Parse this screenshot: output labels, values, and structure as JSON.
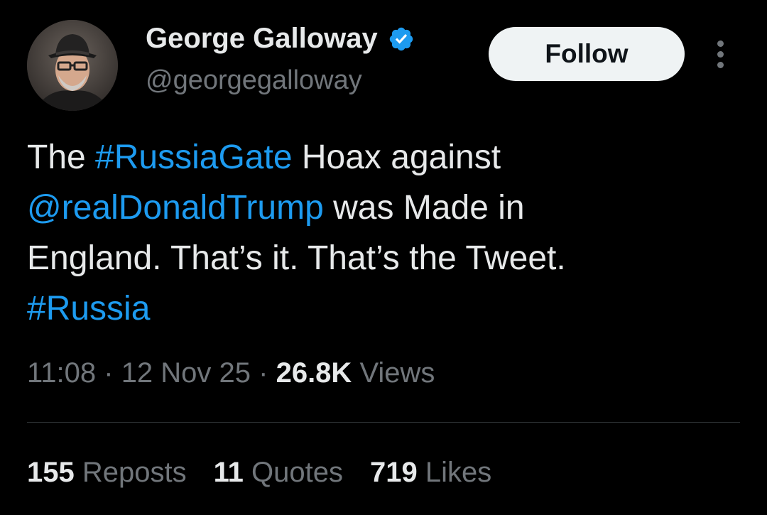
{
  "author": {
    "name": "George Galloway",
    "handle": "@georgegalloway",
    "verified": true,
    "verified_color": "#1d9bf0"
  },
  "follow_label": "Follow",
  "more_icon": "more-vertical-icon",
  "tweet": {
    "lines": [
      [
        {
          "text": "The ",
          "type": "plain"
        },
        {
          "text": "#RussiaGate",
          "type": "hashtag"
        },
        {
          "text": " Hoax against",
          "type": "plain"
        }
      ],
      [
        {
          "text": "@realDonaldTrump",
          "type": "mention"
        },
        {
          "text": " was Made in",
          "type": "plain"
        }
      ],
      [
        {
          "text": "England. That’s it. That’s the Tweet.",
          "type": "plain"
        }
      ],
      [
        {
          "text": "#Russia",
          "type": "hashtag"
        }
      ]
    ],
    "link_color": "#1d9bf0"
  },
  "meta": {
    "time": "11:08",
    "separator1": " · ",
    "date": "12 Nov 25",
    "separator2": " · ",
    "views_count": "26.8K",
    "views_label": " Views"
  },
  "stats": {
    "reposts_count": "155",
    "reposts_label": " Reposts",
    "quotes_count": "11",
    "quotes_label": " Quotes",
    "likes_count": "719",
    "likes_label": " Likes"
  }
}
